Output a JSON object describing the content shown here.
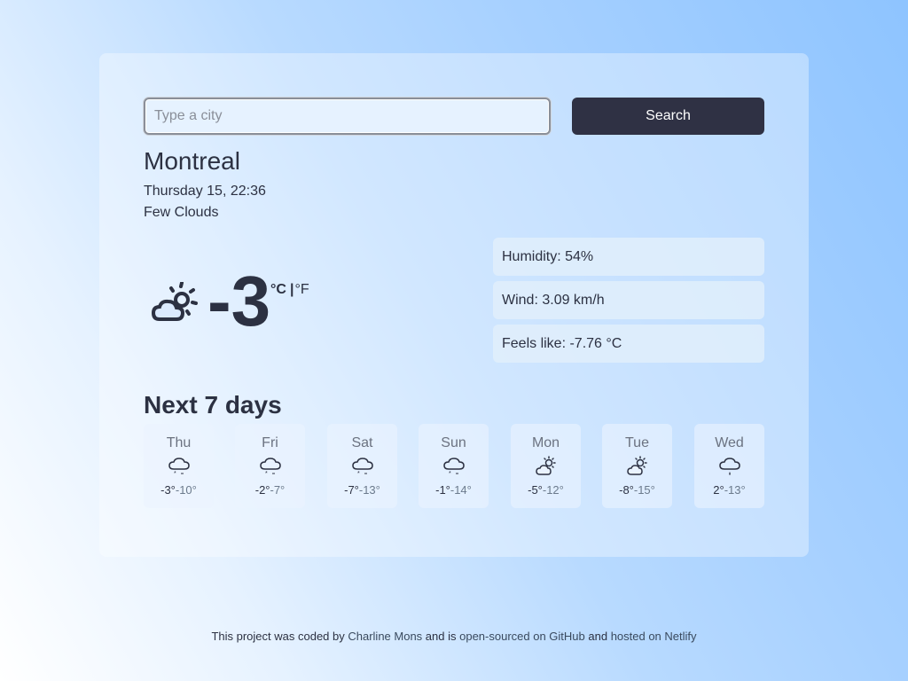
{
  "search": {
    "placeholder": "Type a city",
    "button_label": "Search"
  },
  "current": {
    "city": "Montreal",
    "datetime": "Thursday 15, 22:36",
    "description": "Few Clouds",
    "temperature": "-3",
    "unit_celsius": "°C",
    "unit_separator": "|",
    "unit_fahrenheit": "°F",
    "icon": "partly-cloudy-night-icon",
    "humidity": "Humidity: 54%",
    "wind": "Wind: 3.09 km/h",
    "feels_like": "Feels like: -7.76 °C"
  },
  "forecast": {
    "title": "Next 7 days",
    "days": [
      {
        "name": "Thu",
        "max": "-3°",
        "min": "-10°",
        "icon": "snow-icon"
      },
      {
        "name": "Fri",
        "max": "-2°",
        "min": "-7°",
        "icon": "snow-icon"
      },
      {
        "name": "Sat",
        "max": "-7°",
        "min": "-13°",
        "icon": "snow-icon"
      },
      {
        "name": "Sun",
        "max": "-1°",
        "min": "-14°",
        "icon": "snow-icon"
      },
      {
        "name": "Mon",
        "max": "-5°",
        "min": "-12°",
        "icon": "partly-cloudy-icon"
      },
      {
        "name": "Tue",
        "max": "-8°",
        "min": "-15°",
        "icon": "partly-cloudy-icon"
      },
      {
        "name": "Wed",
        "max": "2°",
        "min": "-13°",
        "icon": "rain-icon"
      }
    ]
  },
  "footer": {
    "prefix": "This project was coded by ",
    "author_link": "Charline Mons",
    "middle": " and is ",
    "github_link": "open-sourced on GitHub",
    "and": " and ",
    "netlify_link": "hosted on Netlify"
  },
  "colors": {
    "button": "#2f3144",
    "text": "#2c3142"
  }
}
